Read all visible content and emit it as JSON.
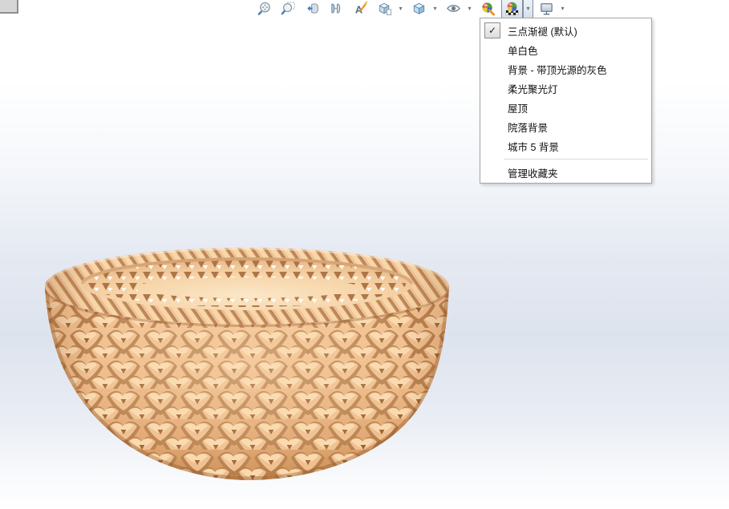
{
  "ui": {
    "dropdown_glyph": "▾"
  },
  "toolbar": {
    "buttons": [
      {
        "name": "zoom-to-fit",
        "icon": "zoom-to-fit-icon",
        "dropdown": false,
        "active": false
      },
      {
        "name": "zoom-to-area",
        "icon": "zoom-to-area-icon",
        "dropdown": false,
        "active": false
      },
      {
        "name": "previous-view",
        "icon": "previous-view-icon",
        "dropdown": false,
        "active": false
      },
      {
        "name": "section-view",
        "icon": "section-view-icon",
        "dropdown": false,
        "active": false
      },
      {
        "name": "dynamic-annotation-views",
        "icon": "annotation-pencil-icon",
        "dropdown": false,
        "active": false
      },
      {
        "name": "view-orientation",
        "icon": "view-cube-icon",
        "dropdown": true,
        "active": false
      },
      {
        "name": "display-style",
        "icon": "shaded-cube-icon",
        "dropdown": true,
        "active": false
      },
      {
        "name": "hide-show-items",
        "icon": "eye-icon",
        "dropdown": true,
        "active": false
      },
      {
        "name": "edit-appearance",
        "icon": "appearance-sphere-icon",
        "dropdown": false,
        "active": false
      },
      {
        "name": "apply-scene",
        "icon": "scene-sphere-icon",
        "dropdown": true,
        "active": true
      },
      {
        "name": "view-settings",
        "icon": "monitor-icon",
        "dropdown": true,
        "active": false
      }
    ]
  },
  "scene_menu": {
    "checkmark_glyph": "✓",
    "items": [
      {
        "label": "三点渐褪 (默认)",
        "checked": true,
        "separator_before": false
      },
      {
        "label": "单白色",
        "checked": false,
        "separator_before": false
      },
      {
        "label": "背景 - 带顶光源的灰色",
        "checked": false,
        "separator_before": false
      },
      {
        "label": "柔光聚光灯",
        "checked": false,
        "separator_before": false
      },
      {
        "label": "屋顶",
        "checked": false,
        "separator_before": false
      },
      {
        "label": "院落背景",
        "checked": false,
        "separator_before": false
      },
      {
        "label": "城市 5 背景",
        "checked": false,
        "separator_before": false
      },
      {
        "label": "管理收藏夹",
        "checked": false,
        "separator_before": true
      }
    ]
  },
  "viewport": {
    "model_name": "woven-basket",
    "colors": {
      "basket_base": "#eeb988",
      "basket_highlight": "#f8d6a9",
      "basket_shadow": "#c08a57",
      "background_mid": "#dde3ee"
    }
  }
}
